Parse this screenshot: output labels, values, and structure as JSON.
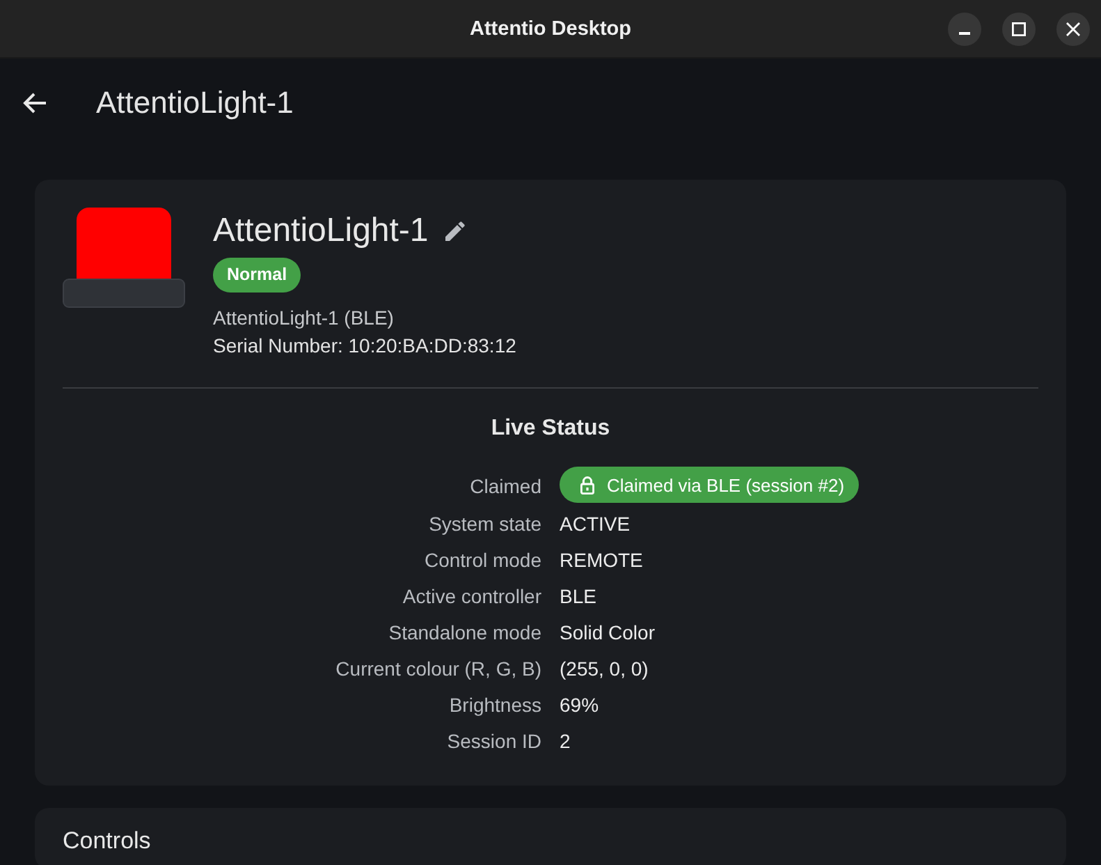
{
  "window": {
    "title": "Attentio Desktop"
  },
  "app_bar": {
    "title": "AttentioLight-1"
  },
  "device": {
    "name": "AttentioLight-1",
    "lamp": {
      "color": "#ff0000"
    },
    "status_badge": {
      "label": "Normal"
    },
    "subtitle": "AttentioLight-1 (BLE)",
    "serial": "Serial Number: 10:20:BA:DD:83:12"
  },
  "live_status": {
    "title": "Live Status",
    "rows": [
      {
        "label": "Claimed",
        "value": "Claimed via BLE (session #2)",
        "kind": "pill"
      },
      {
        "label": "System state",
        "value": "ACTIVE",
        "kind": "text"
      },
      {
        "label": "Control mode",
        "value": "REMOTE",
        "kind": "text"
      },
      {
        "label": "Active controller",
        "value": "BLE",
        "kind": "text"
      },
      {
        "label": "Standalone mode",
        "value": "Solid Color",
        "kind": "text"
      },
      {
        "label": "Current colour (R, G, B)",
        "value": "(255, 0, 0)",
        "kind": "text"
      },
      {
        "label": "Brightness",
        "value": "69%",
        "kind": "text"
      },
      {
        "label": "Session ID",
        "value": "2",
        "kind": "text"
      }
    ]
  },
  "controls": {
    "title": "Controls"
  }
}
